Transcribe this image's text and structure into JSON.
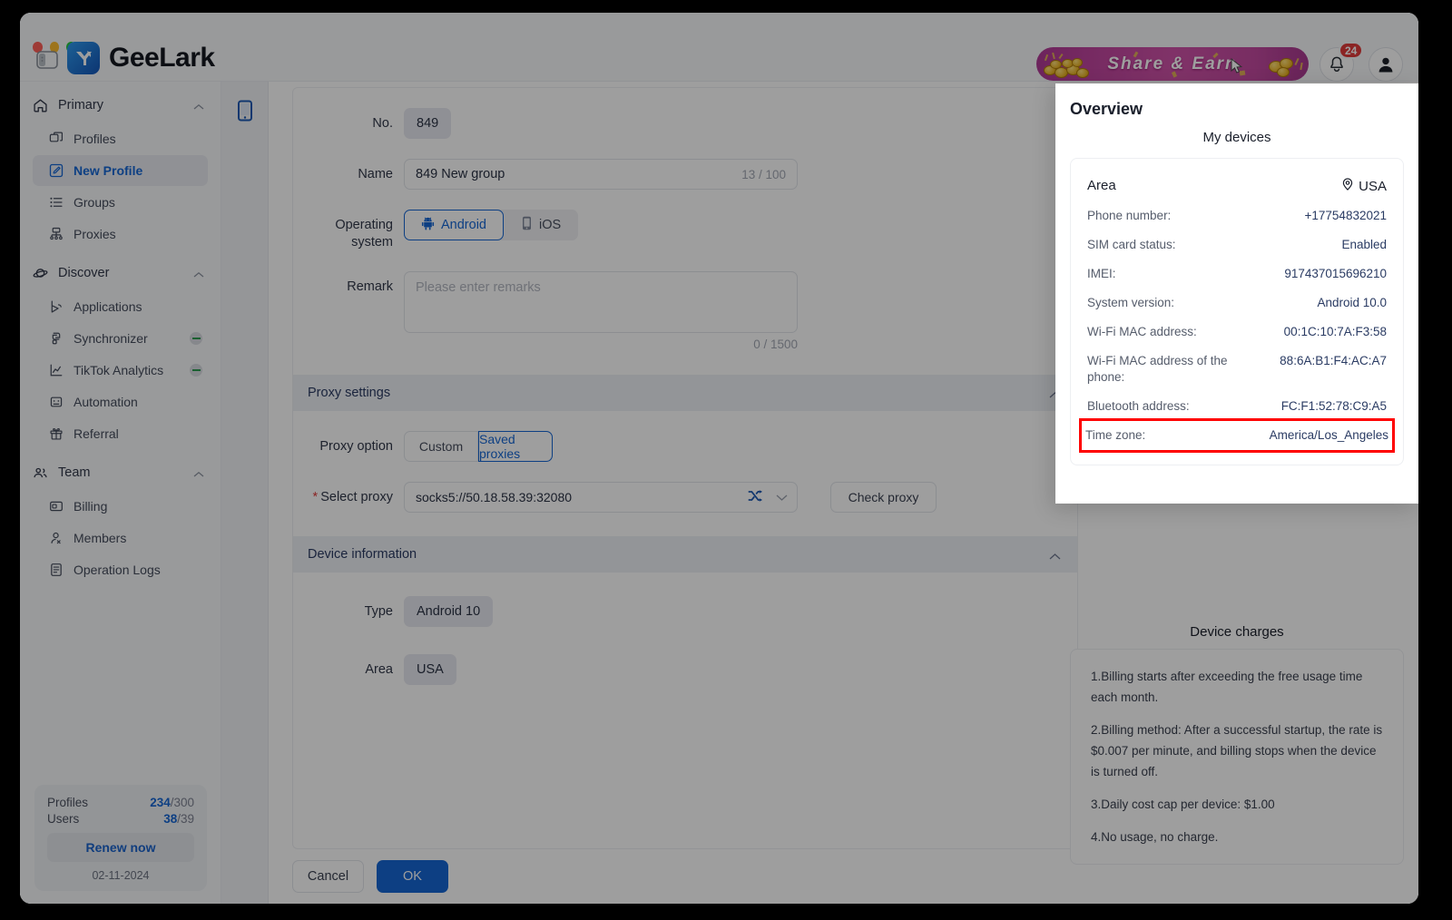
{
  "window": {
    "traffic_lights": [
      "close",
      "minimize",
      "maximize"
    ]
  },
  "header": {
    "brand_name": "GeeLark",
    "panel_toggle_icon": "sidebar-toggle-icon",
    "share_banner_label": "Share & Earn",
    "notification_count": "24",
    "bell_icon": "bell-icon",
    "avatar_icon": "user-avatar-icon"
  },
  "sidebar": {
    "groups": [
      {
        "label": "Primary",
        "icon": "home-icon",
        "items": [
          {
            "label": "Profiles",
            "icon": "profiles-icon",
            "active": false,
            "badge": false
          },
          {
            "label": "New Profile",
            "icon": "edit-square-icon",
            "active": true,
            "badge": false
          },
          {
            "label": "Groups",
            "icon": "list-icon",
            "active": false,
            "badge": false
          },
          {
            "label": "Proxies",
            "icon": "network-icon",
            "active": false,
            "badge": false
          }
        ]
      },
      {
        "label": "Discover",
        "icon": "planet-icon",
        "items": [
          {
            "label": "Applications",
            "icon": "apps-icon",
            "active": false,
            "badge": false
          },
          {
            "label": "Synchronizer",
            "icon": "sync-icon",
            "active": false,
            "badge": true
          },
          {
            "label": "TikTok Analytics",
            "icon": "chart-line-icon",
            "active": false,
            "badge": true
          },
          {
            "label": "Automation",
            "icon": "robot-icon",
            "active": false,
            "badge": false
          },
          {
            "label": "Referral",
            "icon": "gift-icon",
            "active": false,
            "badge": false
          }
        ]
      },
      {
        "label": "Team",
        "icon": "team-icon",
        "items": [
          {
            "label": "Billing",
            "icon": "card-icon",
            "active": false,
            "badge": false
          },
          {
            "label": "Members",
            "icon": "person-icon",
            "active": false,
            "badge": false
          },
          {
            "label": "Operation Logs",
            "icon": "document-icon",
            "active": false,
            "badge": false
          }
        ]
      }
    ],
    "plan": {
      "profiles_label": "Profiles",
      "profiles_used": "234",
      "profiles_total": "/300",
      "users_label": "Users",
      "users_used": "38",
      "users_total": "/39",
      "renew_label": "Renew now",
      "date": "02-11-2024"
    }
  },
  "vtabs": {
    "device_tab_icon": "phone-icon"
  },
  "form": {
    "no": {
      "label": "No.",
      "value": "849"
    },
    "name": {
      "label": "Name",
      "value": "849 New group",
      "counter": "13 / 100"
    },
    "os": {
      "label": "Operating system",
      "options": [
        {
          "label": "Android",
          "icon": "android-icon",
          "selected": true
        },
        {
          "label": "iOS",
          "icon": "apple-phone-icon",
          "selected": false
        }
      ]
    },
    "remark": {
      "label": "Remark",
      "value": "",
      "placeholder": "Please enter remarks",
      "counter": "0 / 1500"
    },
    "proxy_section": {
      "title": "Proxy settings",
      "option_label": "Proxy option",
      "options": [
        {
          "label": "Custom",
          "selected": false
        },
        {
          "label": "Saved proxies",
          "selected": true
        }
      ],
      "select_label": "Select proxy",
      "select_value": "socks5://50.18.58.39:32080",
      "shuffle_icon": "shuffle-icon",
      "dropdown_icon": "chevron-down-icon",
      "check_button": "Check proxy"
    },
    "device_section": {
      "title": "Device information",
      "rows": [
        {
          "label": "Type",
          "value": "Android 10"
        },
        {
          "label": "Area",
          "value": "USA"
        }
      ]
    },
    "footer": {
      "cancel": "Cancel",
      "ok": "OK"
    }
  },
  "overview": {
    "title": "Overview",
    "my_devices_title": "My devices",
    "area_label": "Area",
    "area_value": "USA",
    "area_icon": "location-pin-icon",
    "rows": [
      {
        "key": "Phone number:",
        "value": "+17754832021",
        "highlight": false
      },
      {
        "key": "SIM card status:",
        "value": "Enabled",
        "highlight": false
      },
      {
        "key": "IMEI:",
        "value": "917437015696210",
        "highlight": false
      },
      {
        "key": "System version:",
        "value": "Android 10.0",
        "highlight": false
      },
      {
        "key": "Wi-Fi MAC address:",
        "value": "00:1C:10:7A:F3:58",
        "highlight": false
      },
      {
        "key": "Wi-Fi MAC address of the phone:",
        "value": "88:6A:B1:F4:AC:A7",
        "highlight": false
      },
      {
        "key": "Bluetooth address:",
        "value": "FC:F1:52:78:C9:A5",
        "highlight": false
      },
      {
        "key": "Time zone:",
        "value": "America/Los_Angeles",
        "highlight": true
      }
    ],
    "charges_title": "Device charges",
    "charges": [
      "1.Billing starts after exceeding the free usage time each month.",
      "2.Billing method: After a successful startup, the rate is $0.007 per minute, and billing stops when the device is turned off.",
      "3.Daily cost cap per device: $1.00",
      "4.No usage, no charge."
    ]
  },
  "colors": {
    "accent_blue": "#1667d4",
    "highlight_red": "#ff0000",
    "badge_red": "#e03b3b",
    "banner_pink": "#c0459f"
  }
}
